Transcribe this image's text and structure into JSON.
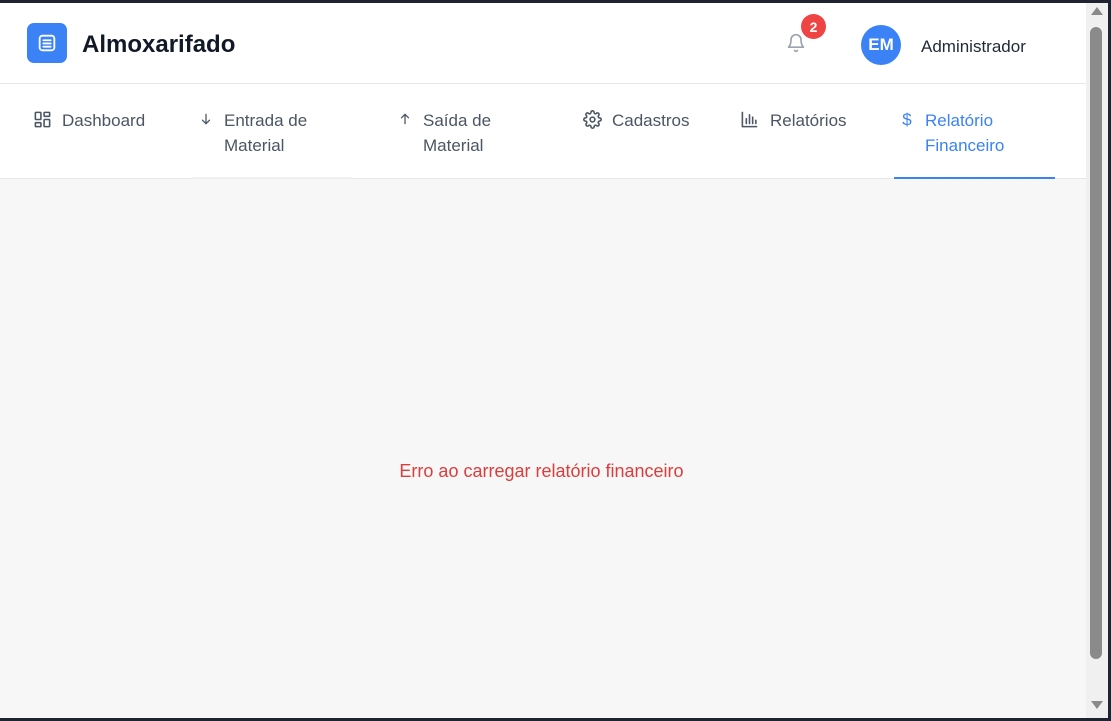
{
  "header": {
    "logo_icon": "warehouse-icon",
    "app_title": "Almoxarifado",
    "notification_icon": "bell-icon",
    "notification_count": "2",
    "avatar_initials": "EM",
    "user_name": "Administrador"
  },
  "nav": {
    "tabs": [
      {
        "label": "Dashboard",
        "icon": "grid-icon",
        "active": false
      },
      {
        "label": "Entrada de Material",
        "icon": "arrow-down-icon",
        "active": false
      },
      {
        "label": "Saída de Material",
        "icon": "arrow-up-icon",
        "active": false
      },
      {
        "label": "Cadastros",
        "icon": "gear-icon",
        "active": false
      },
      {
        "label": "Relatórios",
        "icon": "bar-chart-icon",
        "active": false
      },
      {
        "label": "Relatório Financeiro",
        "icon": "dollar-icon",
        "active": true
      }
    ]
  },
  "main": {
    "error_message": "Erro ao carregar relatório financeiro"
  },
  "colors": {
    "accent": "#3b82f6",
    "error": "#dc3c3c",
    "badge": "#ef4444",
    "background": "#f7f7f7"
  }
}
